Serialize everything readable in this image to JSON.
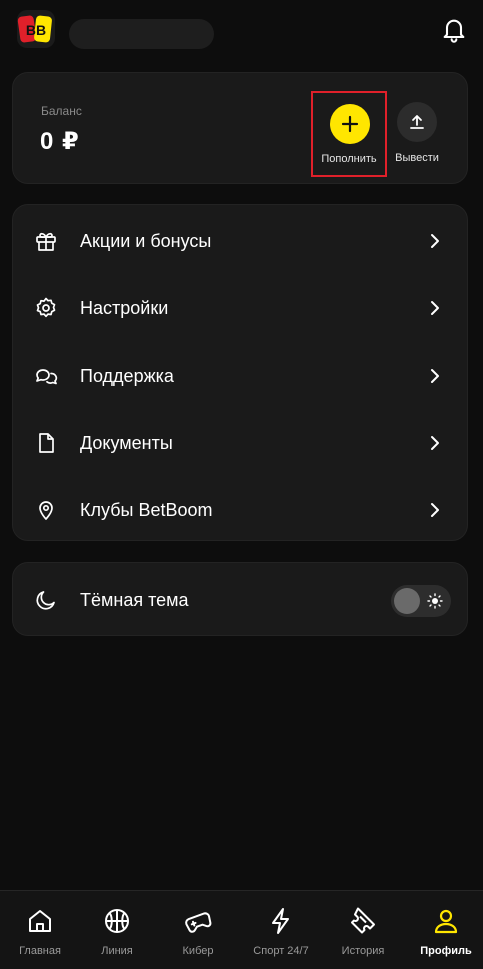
{
  "header": {
    "logo_text": "BB",
    "icons": {
      "logo": "betboom-logo",
      "bell": "bell-icon"
    }
  },
  "balance": {
    "label": "Баланс",
    "value": "0 ₽",
    "deposit_label": "Пополнить",
    "withdraw_label": "Вывести",
    "deposit_highlight_color": "#e0202a",
    "deposit_color": "#ffe600"
  },
  "menu": {
    "items": [
      {
        "label": "Акции и бонусы",
        "icon": "gift-icon"
      },
      {
        "label": "Настройки",
        "icon": "gear-icon"
      },
      {
        "label": "Поддержка",
        "icon": "chat-icon"
      },
      {
        "label": "Документы",
        "icon": "document-icon"
      },
      {
        "label": "Клубы BetBoom",
        "icon": "location-pin-icon"
      }
    ]
  },
  "theme": {
    "label": "Тёмная тема",
    "icon": "moon-icon",
    "toggle_on": false
  },
  "bottom_nav": {
    "items": [
      {
        "label": "Главная",
        "icon": "home-icon"
      },
      {
        "label": "Линия",
        "icon": "basketball-icon"
      },
      {
        "label": "Кибер",
        "icon": "gamepad-icon"
      },
      {
        "label": "Спорт 24/7",
        "icon": "lightning-icon"
      },
      {
        "label": "История",
        "icon": "ticket-icon"
      },
      {
        "label": "Профиль",
        "icon": "user-icon"
      }
    ],
    "active": "Профиль",
    "active_color": "#ffe600"
  }
}
